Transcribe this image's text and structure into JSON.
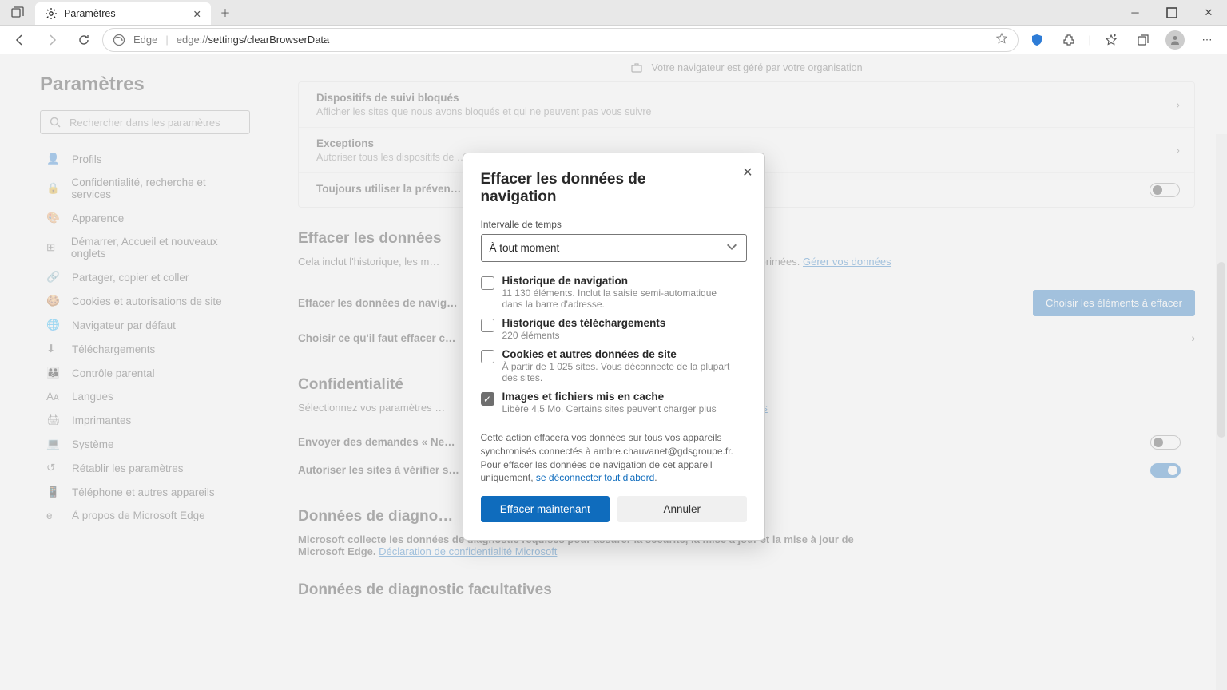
{
  "tab": {
    "title": "Paramètres"
  },
  "address": {
    "prefix": "Edge",
    "url_scheme": "edge://",
    "url_path": "settings/clearBrowserData"
  },
  "banner": "Votre navigateur est géré par votre organisation",
  "sidebar": {
    "heading": "Paramètres",
    "search_placeholder": "Rechercher dans les paramètres",
    "items": [
      "Profils",
      "Confidentialité, recherche et services",
      "Apparence",
      "Démarrer, Accueil et nouveaux onglets",
      "Partager, copier et coller",
      "Cookies et autorisations de site",
      "Navigateur par défaut",
      "Téléchargements",
      "Contrôle parental",
      "Langues",
      "Imprimantes",
      "Système",
      "Rétablir les paramètres",
      "Téléphone et autres appareils",
      "À propos de Microsoft Edge"
    ]
  },
  "panel": {
    "row1_title": "Dispositifs de suivi bloqués",
    "row1_desc": "Afficher les sites que nous avons bloqués et qui ne peuvent pas vous suivre",
    "row2_title": "Exceptions",
    "row2_desc": "Autoriser tous les dispositifs de …",
    "row3_title": "Toujours utiliser la préven…"
  },
  "sections": {
    "clear_heading": "Effacer les données",
    "clear_desc_prefix": "Cela inclut l'historique, les m…",
    "clear_desc_suffix": "… supprimées.",
    "clear_link": "Gérer vos données",
    "clear_row1": "Effacer les données de navig…",
    "clear_btn": "Choisir les éléments à effacer",
    "clear_row2": "Choisir ce qu'il faut effacer c…",
    "privacy_heading": "Confidentialité",
    "privacy_desc": "Sélectionnez vos paramètres …",
    "privacy_link": "…amètres",
    "privacy_row1": "Envoyer des demandes « Ne…",
    "privacy_row2": "Autoriser les sites à vérifier s…",
    "diag_heading": "Données de diagno…",
    "diag_text_prefix": "Microsoft collecte les données de diagnostic requises pour assurer la sécurité, la mise à jour et la mise à jour de Microsoft Edge.",
    "diag_link": "Déclaration de confidentialité Microsoft",
    "diag2_heading": "Données de diagnostic facultatives"
  },
  "modal": {
    "title": "Effacer les données de navigation",
    "interval_label": "Intervalle de temps",
    "interval_value": "À tout moment",
    "items": [
      {
        "title": "Historique de navigation",
        "desc": "11 130 éléments. Inclut la saisie semi-automatique dans la barre d'adresse.",
        "checked": false
      },
      {
        "title": "Historique des téléchargements",
        "desc": "220 éléments",
        "checked": false
      },
      {
        "title": "Cookies et autres données de site",
        "desc": "À partir de 1 025 sites. Vous déconnecte de la plupart des sites.",
        "checked": false
      },
      {
        "title": "Images et fichiers mis en cache",
        "desc": "Libère 4,5 Mo. Certains sites peuvent charger plus",
        "checked": true
      }
    ],
    "footnote_prefix": "Cette action effacera vos données sur tous vos appareils synchronisés connectés à ambre.chauvanet@gdsgroupe.fr. Pour effacer les données de navigation de cet appareil uniquement, ",
    "footnote_link": "se déconnecter tout d'abord",
    "btn_clear": "Effacer maintenant",
    "btn_cancel": "Annuler"
  }
}
